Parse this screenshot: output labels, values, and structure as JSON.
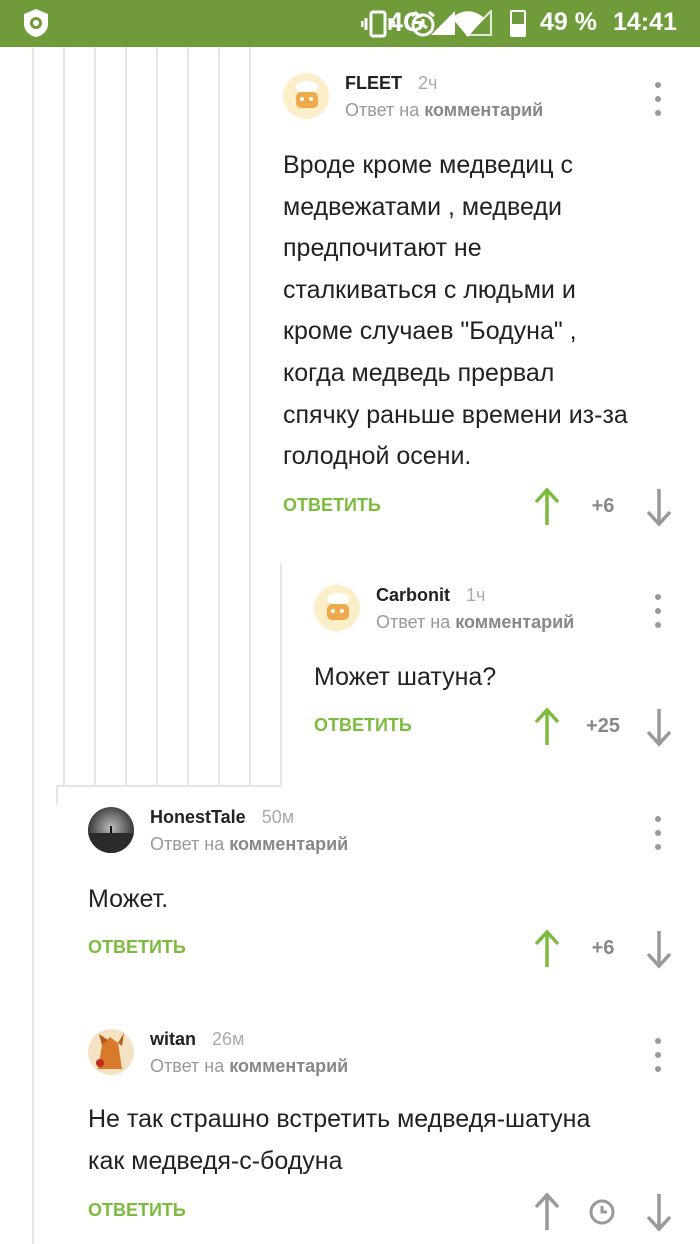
{
  "status_bar": {
    "app_icon": "pikabu-icon",
    "network": "4G",
    "battery": "49 %",
    "battery_level": 0.49,
    "time": "14:41"
  },
  "comments": [
    {
      "user": "FLEET",
      "time": "2ч",
      "reply_prefix": "Ответ на",
      "reply_link": "комментарий",
      "body": [
        "Вроде кроме медведиц с",
        "медвежатами , медведи",
        "предпочитают не",
        "сталкиваться с людьми и",
        "кроме случаев \"Бодуна\" ,",
        "когда медведь прервал",
        "спячку раньше времени из-за",
        "голодной осени."
      ],
      "reply_button": "ОТВЕТИТЬ",
      "score": "+6",
      "avatar": "bread-avatar"
    },
    {
      "user": "Carbonit",
      "time": "1ч",
      "reply_prefix": "Ответ на",
      "reply_link": "комментарий",
      "body": [
        "Может шатуна?"
      ],
      "reply_button": "ОТВЕТИТЬ",
      "score": "+25",
      "avatar": "bread-avatar"
    },
    {
      "user": "HonestTale",
      "time": "50м",
      "reply_prefix": "Ответ на",
      "reply_link": "комментарий",
      "body": [
        "Может."
      ],
      "reply_button": "ОТВЕТИТЬ",
      "score": "+6",
      "avatar": "foggy-landscape-avatar"
    },
    {
      "user": "witan",
      "time": "26м",
      "reply_prefix": "Ответ на",
      "reply_link": "комментарий",
      "body": [
        "Не так страшно встретить медведя-шатуна",
        "как медведя-с-бодуна"
      ],
      "reply_button": "ОТВЕТИТЬ",
      "score_pending_icon": "clock-icon",
      "avatar": "fox-avatar"
    }
  ],
  "colors": {
    "status_bar": "#6f9b3a",
    "accent_green": "#7cbb3d",
    "upvoted_arrow": "#7cbb3d",
    "neutral_arrow": "#999999",
    "thread_lines": "#e6e6e6"
  }
}
